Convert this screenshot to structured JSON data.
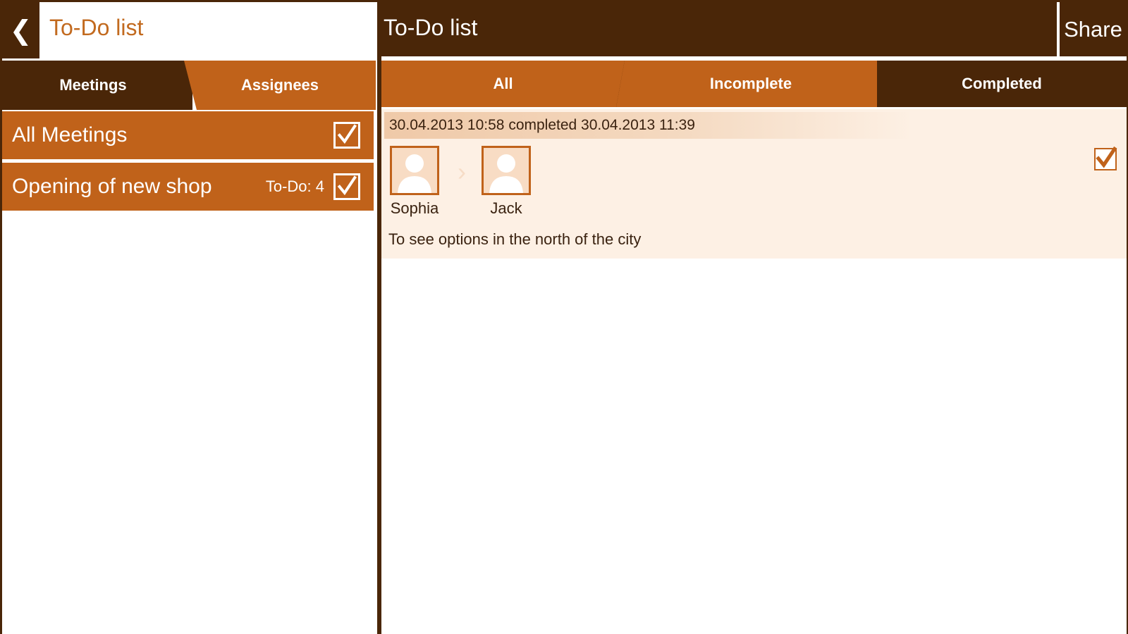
{
  "left": {
    "back_icon": "chevron-left-icon",
    "title": "To-Do list",
    "tabs": [
      {
        "label": "Meetings",
        "active": true
      },
      {
        "label": "Assignees",
        "active": false
      }
    ],
    "meetings": [
      {
        "name": "All Meetings",
        "count": "",
        "checked": true
      },
      {
        "name": "Opening of new shop",
        "count": "To-Do: 4",
        "checked": true
      }
    ]
  },
  "right": {
    "title": "To-Do list",
    "share_label": "Share",
    "tabs": [
      {
        "label": "All",
        "active": false
      },
      {
        "label": "Incomplete",
        "active": false
      },
      {
        "label": "Completed",
        "active": true
      }
    ],
    "tasks": [
      {
        "dates": "30.04.2013 10:58  completed 30.04.2013 11:39",
        "from": "Sophia",
        "to": "Jack",
        "description": "To see options in the north of the city",
        "checked": true
      }
    ]
  },
  "colors": {
    "dark_brown": "#4a2608",
    "orange": "#c0621a",
    "title_orange": "#c26a1f",
    "card_bg": "#fdf0e4"
  }
}
